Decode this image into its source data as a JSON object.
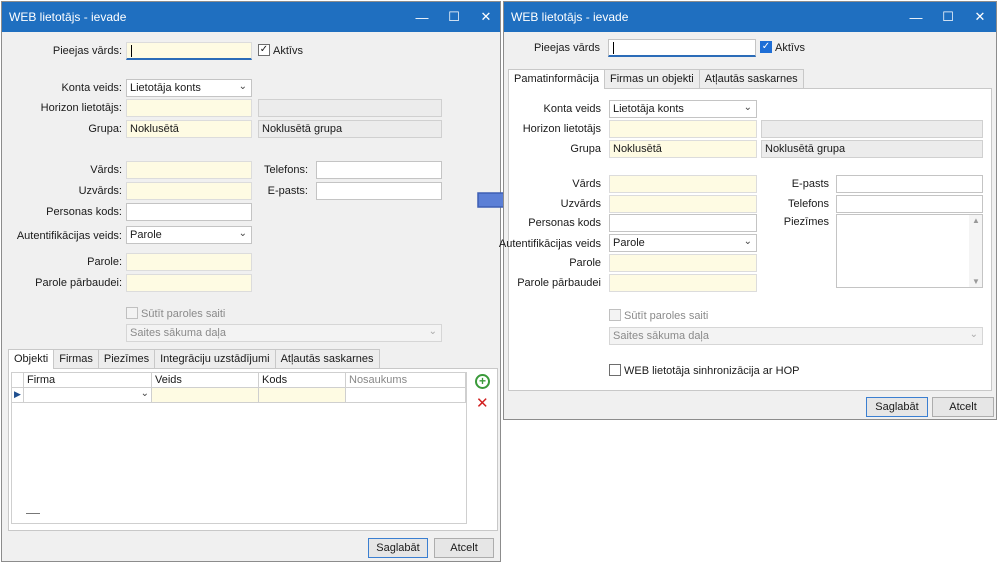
{
  "window_left": {
    "title": "WEB lietotājs - ievade",
    "fields": {
      "pieejas_vards": "Pieejas vārds:",
      "aktivs": "Aktīvs",
      "konta_veids": "Konta veids:",
      "konta_veids_value": "Lietotāja konts",
      "horizon_lietotajs": "Horizon lietotājs:",
      "grupa": "Grupa:",
      "grupa_value": "Noklusētā",
      "grupa_desc": "Noklusētā grupa",
      "vards": "Vārds:",
      "uzvards": "Uzvārds:",
      "personas_kods": "Personas kods:",
      "autentifikacijas_veids": "Autentifikācijas veids:",
      "autentifikacijas_value": "Parole",
      "parole": "Parole:",
      "parole_parbaudei": "Parole pārbaudei:",
      "telefons": "Telefons:",
      "e_pasts": "E-pasts:",
      "sutit_paroles_saiti": "Sūtīt paroles saiti",
      "saites_sakuma_dala": "Saites sākuma daļa"
    },
    "tabs": [
      "Objekti",
      "Firmas",
      "Piezīmes",
      "Integrāciju uzstādījumi",
      "Atļautās saskarnes"
    ],
    "grid_columns": [
      "Firma",
      "Veids",
      "Kods",
      "Nosaukums"
    ],
    "buttons": {
      "save": "Saglabāt",
      "cancel": "Atcelt"
    }
  },
  "window_right": {
    "title": "WEB lietotājs - ievade",
    "fields": {
      "pieejas_vards": "Pieejas vārds",
      "aktivs": "Aktīvs",
      "konta_veids": "Konta veids",
      "konta_veids_value": "Lietotāja konts",
      "horizon_lietotajs": "Horizon lietotājs",
      "grupa": "Grupa",
      "grupa_value": "Noklusētā",
      "grupa_desc": "Noklusētā grupa",
      "vards": "Vārds",
      "uzvards": "Uzvārds",
      "personas_kods": "Personas kods",
      "autentifikacijas_veids": "Autentifikācijas veids",
      "autentifikacijas_value": "Parole",
      "parole": "Parole",
      "parole_parbaudei": "Parole pārbaudei",
      "e_pasts": "E-pasts",
      "telefons": "Telefons",
      "piezimes": "Piezīmes",
      "sutit_paroles_saiti": "Sūtīt paroles saiti",
      "saites_sakuma_dala": "Saites sākuma daļa",
      "web_sinhronizacija": "WEB lietotāja sinhronizācija ar HOP"
    },
    "tabs": [
      "Pamatinformācija",
      "Firmas un objekti",
      "Atļautās saskarnes"
    ],
    "buttons": {
      "save": "Saglabāt",
      "cancel": "Atcelt"
    }
  },
  "arrow_color": "#5b7fd6",
  "titlebar_color": "#1f6fc0"
}
